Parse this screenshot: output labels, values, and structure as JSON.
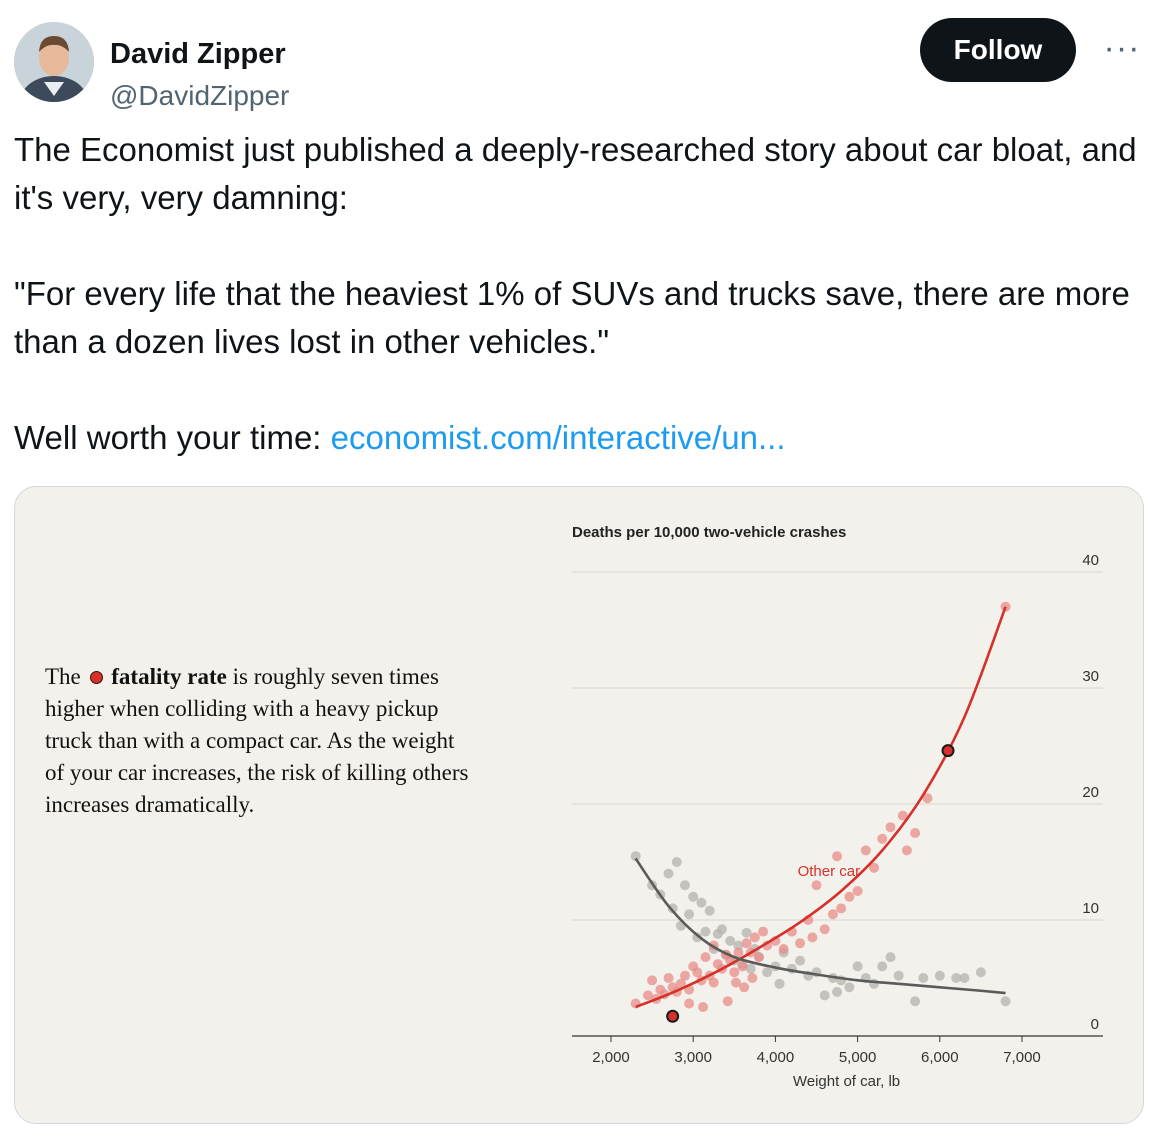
{
  "author": {
    "name": "David Zipper",
    "handle": "@DavidZipper",
    "avatar_icon": "avatar-photo"
  },
  "actions": {
    "follow_label": "Follow",
    "more_label": "···"
  },
  "tweet": {
    "line1": "The Economist just published a deeply-researched story about car bloat, and it's very, very damning:",
    "line2": "\"For every life that the heaviest 1% of SUVs and trucks save, there are more than a dozen lives lost in other vehicles.\"",
    "line3_prefix": "Well worth your time: ",
    "link_text": "economist.com/interactive/un..."
  },
  "card": {
    "caption_before": "The",
    "caption_bold": "fatality rate",
    "caption_after": "is roughly seven times higher when colliding with a heavy pickup truck than with a compact car. As the weight of your car increases, the risk of killing others increases dramatically."
  },
  "colors": {
    "accent_red": "#d6302a",
    "own_car_gray": "#5a5a5a",
    "link_blue": "#1d9bf0"
  },
  "chart_data": {
    "type": "scatter",
    "title": "Deaths per 10,000 two-vehicle crashes",
    "xlabel": "Weight of car, lb",
    "ylabel": "",
    "xlim": [
      1500,
      7800
    ],
    "ylim": [
      0,
      40
    ],
    "x_ticks": [
      2000,
      3000,
      4000,
      5000,
      6000,
      7000
    ],
    "x_tick_labels": [
      "2,000",
      "3,000",
      "4,000",
      "5,000",
      "6,000",
      "7,000"
    ],
    "y_ticks": [
      0,
      10,
      20,
      30,
      40
    ],
    "y_tick_labels": [
      "0",
      "10",
      "20",
      "30",
      "40"
    ],
    "annotation": "Other car",
    "series": [
      {
        "name": "Other car",
        "color": "#d6302a",
        "points": [
          [
            2300,
            2.8
          ],
          [
            2450,
            3.5
          ],
          [
            2500,
            4.8
          ],
          [
            2550,
            3.2
          ],
          [
            2600,
            4.0
          ],
          [
            2650,
            3.6
          ],
          [
            2700,
            5.0
          ],
          [
            2750,
            4.2
          ],
          [
            2800,
            3.8
          ],
          [
            2850,
            4.5
          ],
          [
            2900,
            5.2
          ],
          [
            2950,
            4.0
          ],
          [
            3000,
            6.0
          ],
          [
            3050,
            5.5
          ],
          [
            3100,
            4.8
          ],
          [
            3150,
            6.8
          ],
          [
            3200,
            5.2
          ],
          [
            3250,
            4.6
          ],
          [
            3300,
            6.2
          ],
          [
            3350,
            5.8
          ],
          [
            3400,
            7.0
          ],
          [
            3450,
            6.5
          ],
          [
            3500,
            5.5
          ],
          [
            3550,
            7.2
          ],
          [
            3600,
            6.0
          ],
          [
            3650,
            8.0
          ],
          [
            3700,
            7.2
          ],
          [
            3750,
            8.5
          ],
          [
            3800,
            6.8
          ],
          [
            3850,
            9.0
          ],
          [
            3900,
            7.8
          ],
          [
            4000,
            8.2
          ],
          [
            4100,
            7.5
          ],
          [
            4200,
            9.0
          ],
          [
            4300,
            8.0
          ],
          [
            4400,
            10.0
          ],
          [
            4450,
            8.5
          ],
          [
            4500,
            13.0
          ],
          [
            4600,
            9.2
          ],
          [
            4700,
            10.5
          ],
          [
            4750,
            15.5
          ],
          [
            4800,
            11.0
          ],
          [
            4900,
            12.0
          ],
          [
            5000,
            12.5
          ],
          [
            5100,
            16.0
          ],
          [
            5200,
            14.5
          ],
          [
            5300,
            17.0
          ],
          [
            5400,
            18.0
          ],
          [
            5550,
            19.0
          ],
          [
            5600,
            16.0
          ],
          [
            5700,
            17.5
          ],
          [
            5850,
            20.5
          ],
          [
            6800,
            37.0
          ],
          [
            3420,
            3.0
          ],
          [
            3520,
            4.6
          ],
          [
            3620,
            4.2
          ],
          [
            3250,
            7.8
          ],
          [
            3120,
            2.5
          ],
          [
            3720,
            5.0
          ],
          [
            2950,
            2.8
          ]
        ]
      },
      {
        "name": "",
        "color": "#999999",
        "points": [
          [
            2300,
            15.5
          ],
          [
            2500,
            13.0
          ],
          [
            2600,
            12.2
          ],
          [
            2700,
            14.0
          ],
          [
            2750,
            11.0
          ],
          [
            2800,
            15.0
          ],
          [
            2850,
            9.5
          ],
          [
            2900,
            13.0
          ],
          [
            2950,
            10.5
          ],
          [
            3000,
            12.0
          ],
          [
            3050,
            8.5
          ],
          [
            3100,
            11.5
          ],
          [
            3150,
            9.0
          ],
          [
            3200,
            10.8
          ],
          [
            3250,
            7.5
          ],
          [
            3300,
            8.8
          ],
          [
            3400,
            7.0
          ],
          [
            3450,
            8.2
          ],
          [
            3500,
            6.5
          ],
          [
            3550,
            7.8
          ],
          [
            3600,
            6.2
          ],
          [
            3700,
            5.8
          ],
          [
            3750,
            7.5
          ],
          [
            3800,
            6.8
          ],
          [
            3900,
            5.5
          ],
          [
            4000,
            6.0
          ],
          [
            4100,
            7.2
          ],
          [
            4200,
            5.8
          ],
          [
            4300,
            6.5
          ],
          [
            4400,
            5.2
          ],
          [
            4500,
            5.5
          ],
          [
            4600,
            3.5
          ],
          [
            4700,
            5.0
          ],
          [
            4750,
            3.8
          ],
          [
            4800,
            4.8
          ],
          [
            4900,
            4.2
          ],
          [
            5000,
            6.0
          ],
          [
            5100,
            5.0
          ],
          [
            5200,
            4.5
          ],
          [
            5300,
            6.0
          ],
          [
            5400,
            6.8
          ],
          [
            5500,
            5.2
          ],
          [
            5700,
            3.0
          ],
          [
            5800,
            5.0
          ],
          [
            6000,
            5.2
          ],
          [
            6200,
            5.0
          ],
          [
            6300,
            5.0
          ],
          [
            6500,
            5.5
          ],
          [
            6800,
            3.0
          ],
          [
            3350,
            9.2
          ],
          [
            3650,
            8.9
          ],
          [
            4050,
            4.5
          ]
        ]
      }
    ],
    "curves": [
      {
        "name": "Other car",
        "color": "#d6302a",
        "x": [
          2300,
          2800,
          3300,
          3800,
          4300,
          4800,
          5300,
          5800,
          6300,
          6800
        ],
        "y": [
          2.5,
          3.9,
          5.6,
          7.6,
          9.8,
          12.5,
          16.0,
          20.8,
          27.5,
          37.0
        ]
      },
      {
        "name": "",
        "color": "#5a5a5a",
        "x": [
          2300,
          2700,
          3100,
          3500,
          4000,
          4500,
          5000,
          5500,
          6000,
          6500,
          6800
        ],
        "y": [
          15.3,
          11.2,
          8.4,
          6.8,
          5.9,
          5.3,
          4.8,
          4.5,
          4.2,
          3.9,
          3.7
        ]
      }
    ],
    "highlighted_points": [
      [
        2750,
        1.7
      ],
      [
        6100,
        24.6
      ]
    ],
    "grid": true,
    "legend": "none"
  }
}
